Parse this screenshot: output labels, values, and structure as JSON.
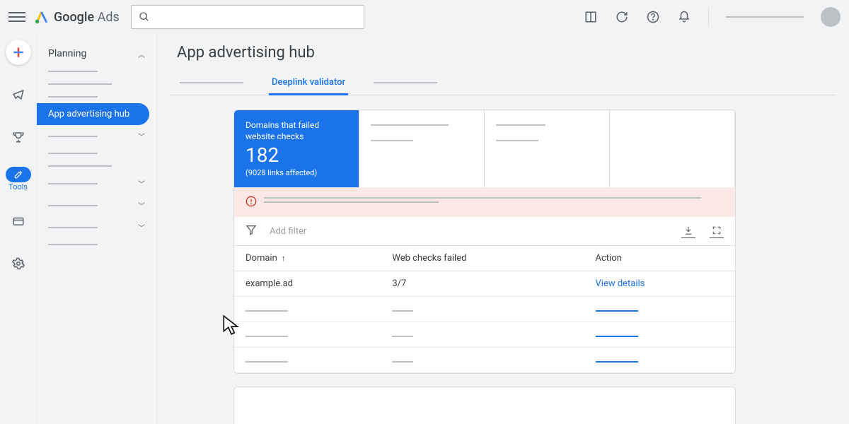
{
  "app_name_1": "Google",
  "app_name_2": "Ads",
  "rail": {
    "tools_label": "Tools"
  },
  "sidenav": {
    "section": "Planning",
    "active_item": "App advertising hub"
  },
  "page": {
    "title": "App advertising hub"
  },
  "tabs": {
    "active": "Deeplink validator"
  },
  "scorecard": {
    "title": "Domains that failed website checks",
    "value": "182",
    "sub": "(9028 links affected)"
  },
  "filter": {
    "placeholder": "Add filter"
  },
  "table": {
    "headers": {
      "domain": "Domain",
      "checks": "Web checks failed",
      "action": "Action"
    },
    "rows": [
      {
        "domain": "example.ad",
        "checks": "3/7",
        "action": "View details"
      }
    ]
  }
}
